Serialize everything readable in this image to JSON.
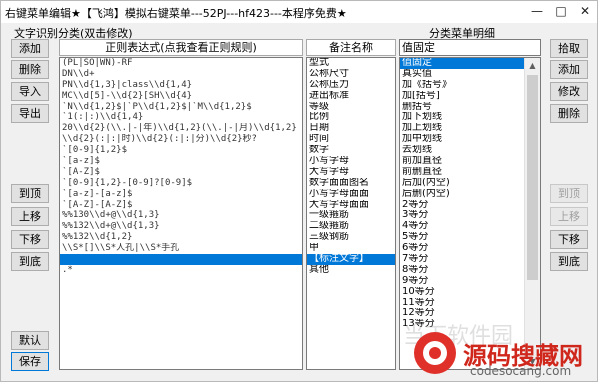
{
  "window": {
    "title": "右键菜单编辑★【飞鸿】模拟右键菜单---52PJ---hf423---本程序免费★",
    "minimize_glyph": "—",
    "maximize_glyph": "□",
    "close_glyph": "✕"
  },
  "left_section_label": "文字识别分类(双击修改)",
  "right_section_label": "分类菜单明细",
  "left_buttons": {
    "add": "添加",
    "delete": "删除",
    "import": "导入",
    "export": "导出",
    "to_top": "到顶",
    "move_up": "上移",
    "move_down": "下移",
    "to_bottom": "到底",
    "default": "默认",
    "save": "保存"
  },
  "right_buttons": {
    "pickup": "拾取",
    "add": "添加",
    "modify": "修改",
    "delete": "删除",
    "to_top": "到顶",
    "move_up": "上移",
    "move_down": "下移",
    "to_bottom": "到底"
  },
  "regex_header": "正则表达式(点我查看正则规则)",
  "notes_header": "备注名称",
  "regex_items": [
    "(PL|SO|WN)-RF",
    "DN\\\\d+",
    "PN\\\\d{1,3}|class\\\\d{1,4}",
    "MC\\\\d[5]-\\\\d{2}[SH\\\\d{4}",
    "`N\\\\d{1,2}$|`P\\\\d{1,2}$|`M\\\\d{1,2}$",
    "`1(:|:)\\\\d{1,4}",
    "20\\\\d{2}(\\\\.|-|年)\\\\d{1,2}(\\\\.|-|月)\\\\d{1,2}",
    "\\\\d{2}(:|:|时)\\\\d{2}(:|:|分)\\\\d{2}秒?",
    "`[0-9]{1,2}$",
    "`[a-z]$",
    "`[A-Z]$",
    "`[0-9]{1,2}-[0-9]?[0-9]$",
    "`[a-z]-[a-z]$",
    "`[A-Z]-[A-Z]$",
    "%%130\\\\d+@\\\\d{1,3}",
    "%%132\\\\d+@\\\\d{1,3}",
    "%%132\\\\d{1,2}",
    "\\\\S*[]\\\\S*人孔|\\\\S*手孔",
    "",
    ".*"
  ],
  "note_items": [
    "型式",
    "公称尺寸",
    "公称压力",
    "进出标准",
    "等级",
    "比例",
    "日期",
    "时间",
    "数字",
    "小写字母",
    "大写字母",
    "数字面面图名",
    "小写字母面面",
    "大写字母面面",
    "一级箍筋",
    "二级箍筋",
    "三级钢筋",
    "甲",
    "【标注文字】",
    "其他"
  ],
  "selected_index": 18,
  "detail_input_value": "值固定",
  "detail_items": [
    "值固定",
    "真实值",
    "加《括号》",
    "加[括号]",
    "删括号",
    "加下划线",
    "加上划线",
    "加中划线",
    "去划线",
    "前加直径",
    "前删直径",
    "后加(内空)",
    "后删(内空)",
    "2等分",
    "3等分",
    "4等分",
    "5等分",
    "6等分",
    "7等分",
    "8等分",
    "9等分",
    "10等分",
    "11等分",
    "12等分",
    "13等分"
  ],
  "detail_selected_index": 0,
  "watermark": {
    "brand_text": "源码搜藏网",
    "url_text": "codesocang.com",
    "faint_text": "当下软件园",
    "brand_color": "#d0271c"
  }
}
